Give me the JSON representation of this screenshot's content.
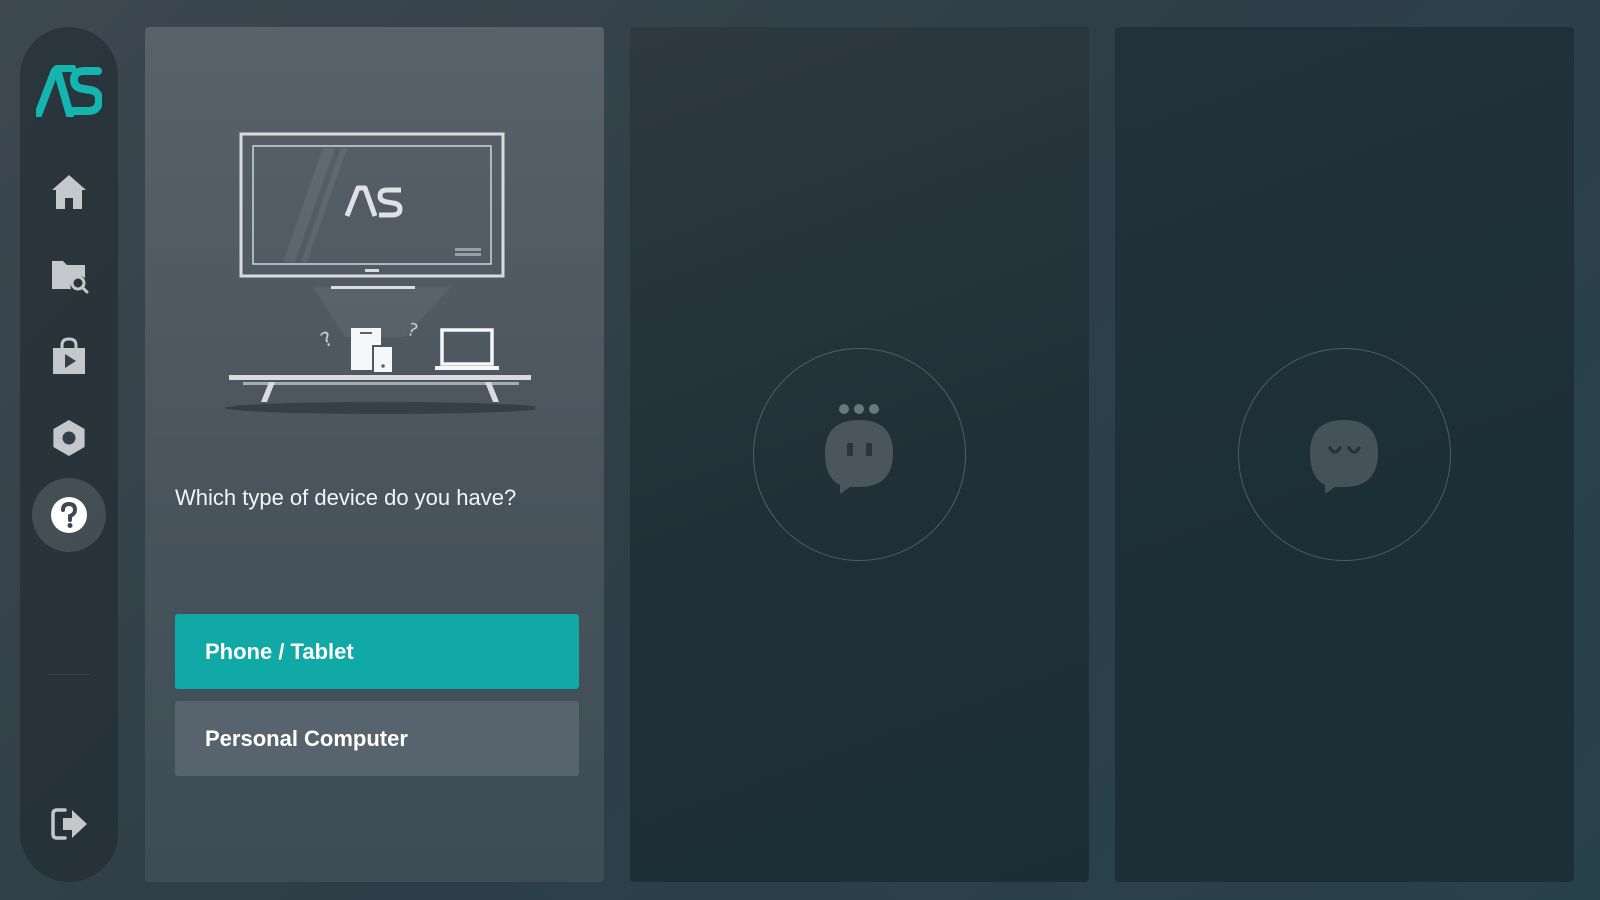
{
  "app": {
    "logo_text": "AS",
    "accent_color": "#10a9a5"
  },
  "sidebar": {
    "items": [
      {
        "name": "home",
        "icon": "home-icon"
      },
      {
        "name": "files",
        "icon": "folder-search-icon"
      },
      {
        "name": "store",
        "icon": "shopping-bag-play-icon"
      },
      {
        "name": "settings",
        "icon": "gear-icon"
      },
      {
        "name": "help",
        "icon": "help-icon",
        "active": true
      }
    ],
    "bottom_item": {
      "name": "exit",
      "icon": "exit-icon"
    }
  },
  "main": {
    "question": "Which type of device do you have?",
    "options": [
      {
        "label": "Phone / Tablet",
        "selected": true
      },
      {
        "label": "Personal Computer",
        "selected": false
      }
    ]
  },
  "placeholders": [
    {
      "icon": "chat-bubble-thinking-icon"
    },
    {
      "icon": "chat-bubble-sleeping-icon"
    }
  ]
}
